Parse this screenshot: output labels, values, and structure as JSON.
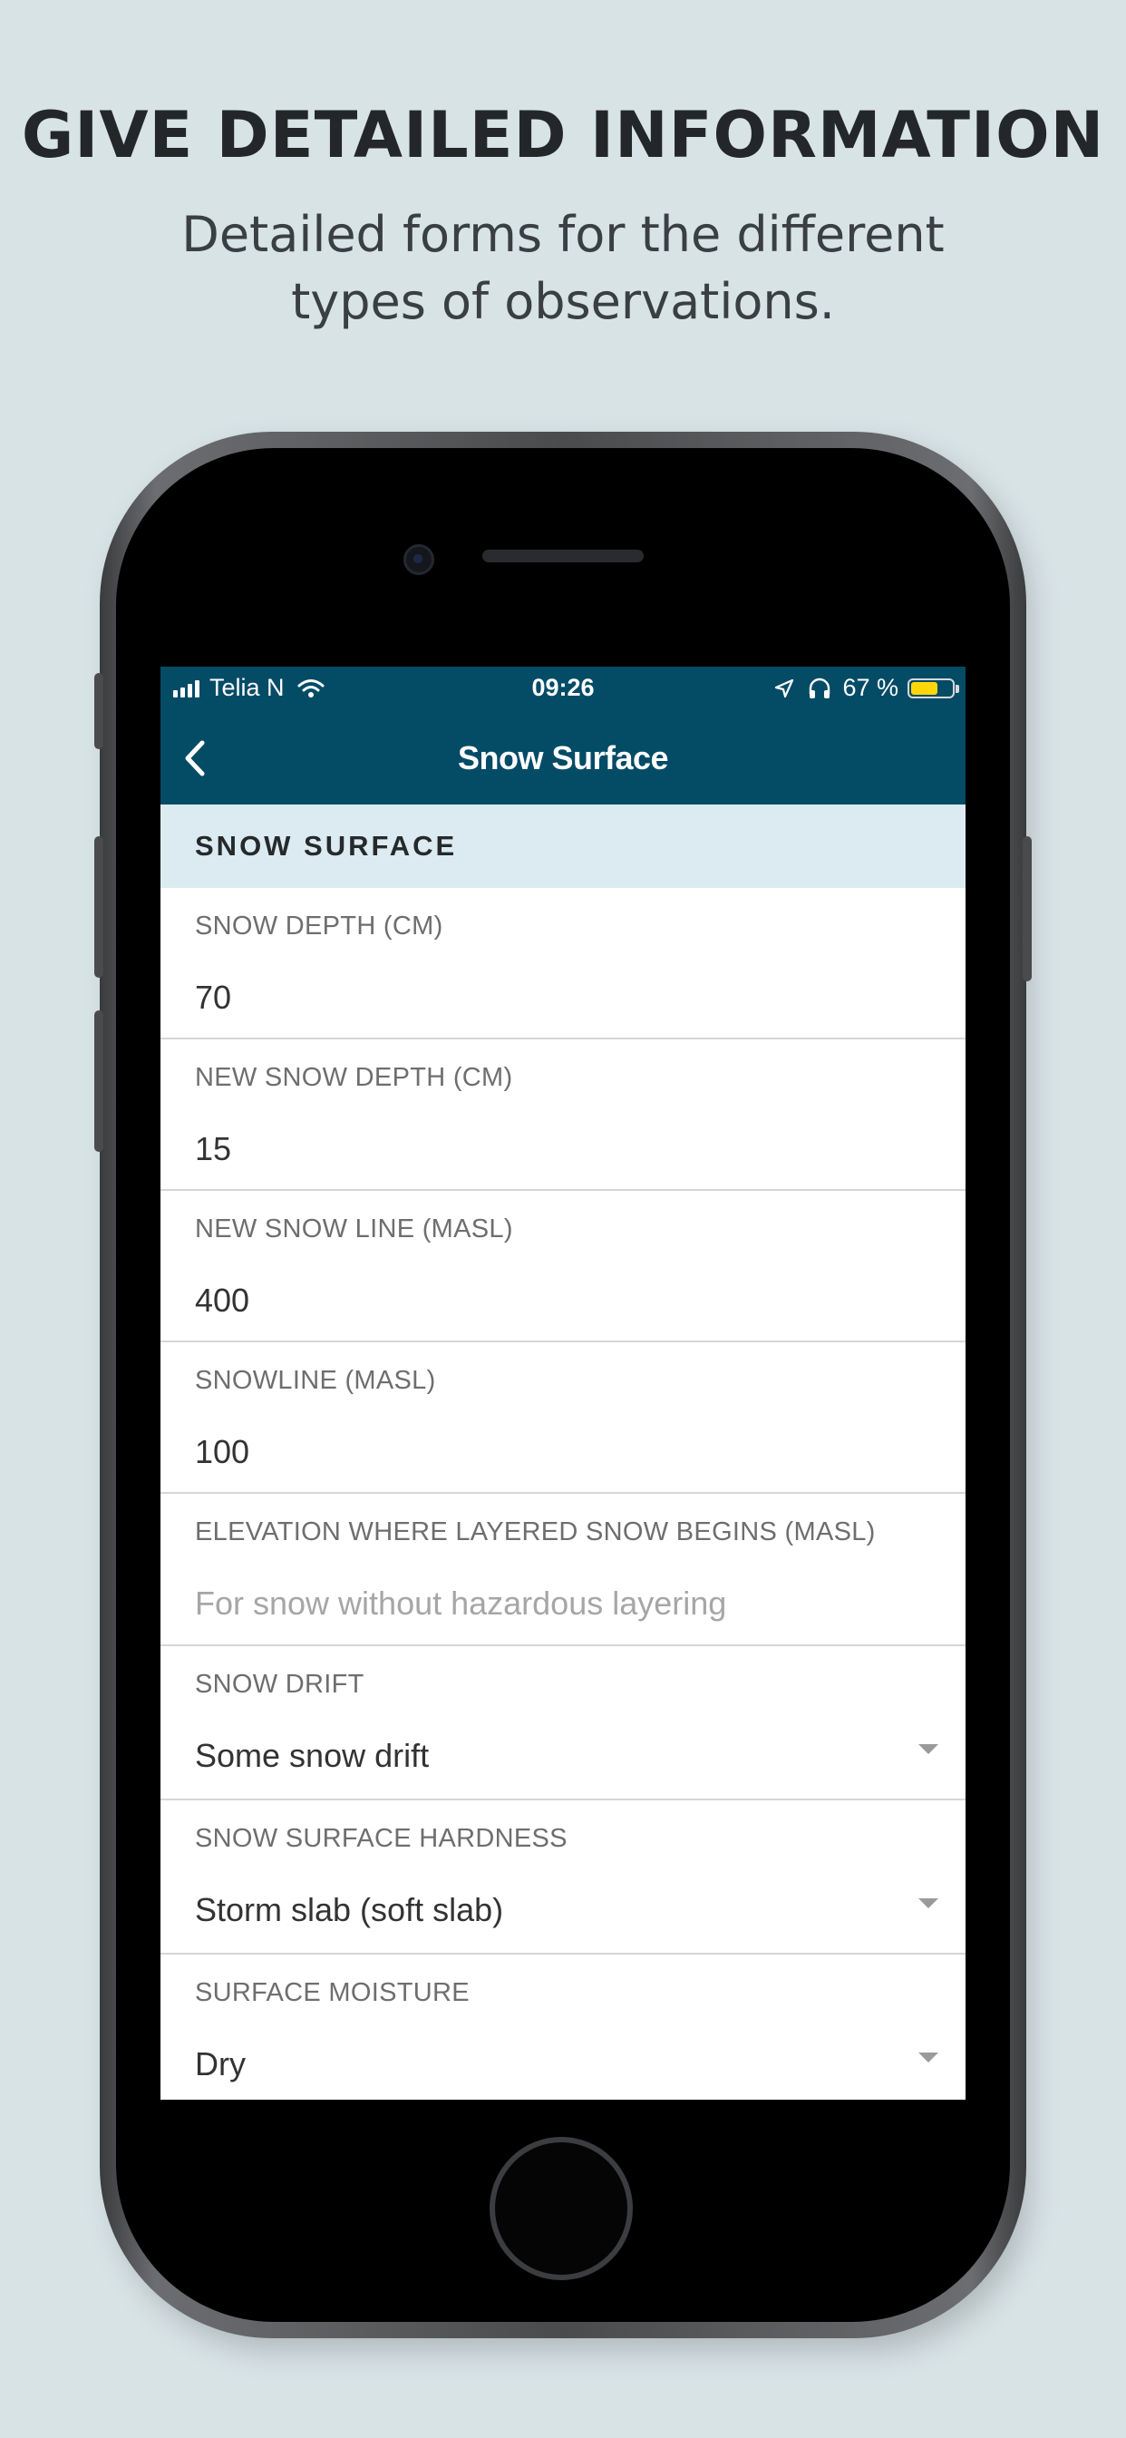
{
  "promo": {
    "headline": "GIVE DETAILED INFORMATION",
    "subline": "Detailed forms for the different types of observations."
  },
  "status_bar": {
    "carrier": "Telia N",
    "time": "09:26",
    "battery_text": "67 %",
    "battery_level": 0.67,
    "battery_color": "#ffd60a"
  },
  "nav": {
    "title": "Snow Surface",
    "bar_color": "#044b66"
  },
  "form": {
    "section_title": "SNOW SURFACE",
    "fields": [
      {
        "label": "SNOW DEPTH (CM)",
        "value": "70"
      },
      {
        "label": "NEW SNOW DEPTH (CM)",
        "value": "15"
      },
      {
        "label": "NEW SNOW LINE (MASL)",
        "value": "400"
      },
      {
        "label": "SNOWLINE (MASL)",
        "value": "100"
      },
      {
        "label": "ELEVATION WHERE LAYERED SNOW BEGINS (MASL)",
        "placeholder": "For snow without hazardous layering"
      },
      {
        "label": "SNOW DRIFT",
        "value": "Some snow drift"
      },
      {
        "label": "SNOW SURFACE HARDNESS",
        "value": "Storm slab (soft slab)"
      },
      {
        "label": "SURFACE MOISTURE",
        "value": "Dry"
      }
    ]
  },
  "icons": [
    "signal-icon",
    "wifi-icon",
    "location-icon",
    "headphones-icon",
    "battery-icon",
    "back-chevron-icon",
    "dropdown-arrow-icon"
  ]
}
